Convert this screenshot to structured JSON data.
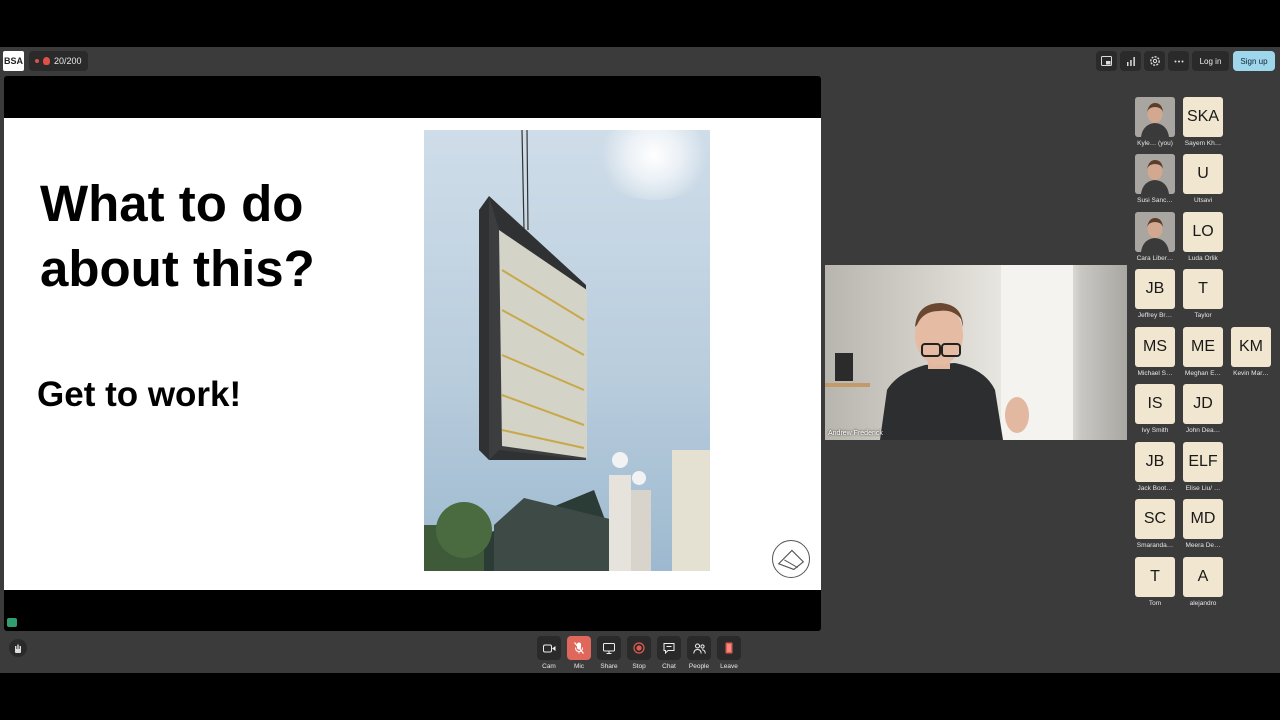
{
  "header": {
    "logo_text": "BSA",
    "participant_count": "20/200",
    "login_label": "Log in",
    "signup_label": "Sign up"
  },
  "slide": {
    "title": "What to do about this?",
    "subtitle": "Get to work!"
  },
  "speaker": {
    "name": "Andrew Frederick"
  },
  "participants": [
    {
      "initials": "",
      "name": "Kyle…  (you)",
      "has_photo": true
    },
    {
      "initials": "SKA",
      "name": "Sayem Kh…",
      "has_photo": false
    },
    {
      "initials": "",
      "name": "Susi Sanc…",
      "has_photo": true
    },
    {
      "initials": "U",
      "name": "Utsavi",
      "has_photo": false
    },
    {
      "initials": "",
      "name": "Cara Liber…",
      "has_photo": true
    },
    {
      "initials": "LO",
      "name": "Luda Orlik",
      "has_photo": false
    },
    {
      "initials": "JB",
      "name": "Jeffrey Br…",
      "has_photo": false
    },
    {
      "initials": "T",
      "name": "Taylor",
      "has_photo": false
    },
    {
      "initials": "MS",
      "name": "Michael S…",
      "has_photo": false
    },
    {
      "initials": "ME",
      "name": "Meghan E…",
      "has_photo": false
    },
    {
      "initials": "KM",
      "name": "Kevin Mar…",
      "has_photo": false
    },
    {
      "initials": "IS",
      "name": "Ivy Smith",
      "has_photo": false
    },
    {
      "initials": "JD",
      "name": "John Dea…",
      "has_photo": false
    },
    {
      "initials": "JB",
      "name": "Jack Boot…",
      "has_photo": false
    },
    {
      "initials": "ELF",
      "name": "Elise Liu/ …",
      "has_photo": false
    },
    {
      "initials": "SC",
      "name": "Smaranda…",
      "has_photo": false
    },
    {
      "initials": "MD",
      "name": "Meera De…",
      "has_photo": false
    },
    {
      "initials": "T",
      "name": "Tom",
      "has_photo": false
    },
    {
      "initials": "A",
      "name": "alejandro",
      "has_photo": false
    }
  ],
  "controls": {
    "cam": "Cam",
    "mic": "Mic",
    "share": "Share",
    "stop": "Stop",
    "chat": "Chat",
    "people": "People",
    "leave": "Leave"
  },
  "icons": [
    "pip-icon",
    "stats-icon",
    "settings-icon",
    "more-icon",
    "camera-icon",
    "mic-muted-icon",
    "screen-share-icon",
    "record-stop-icon",
    "chat-icon",
    "people-icon",
    "leave-icon",
    "volume-icon",
    "hand-icon"
  ],
  "colors": {
    "background": "#3b3b3b",
    "signup": "#9ed6ec",
    "mic_muted": "#e0675c",
    "tile": "#f1e6cf"
  }
}
